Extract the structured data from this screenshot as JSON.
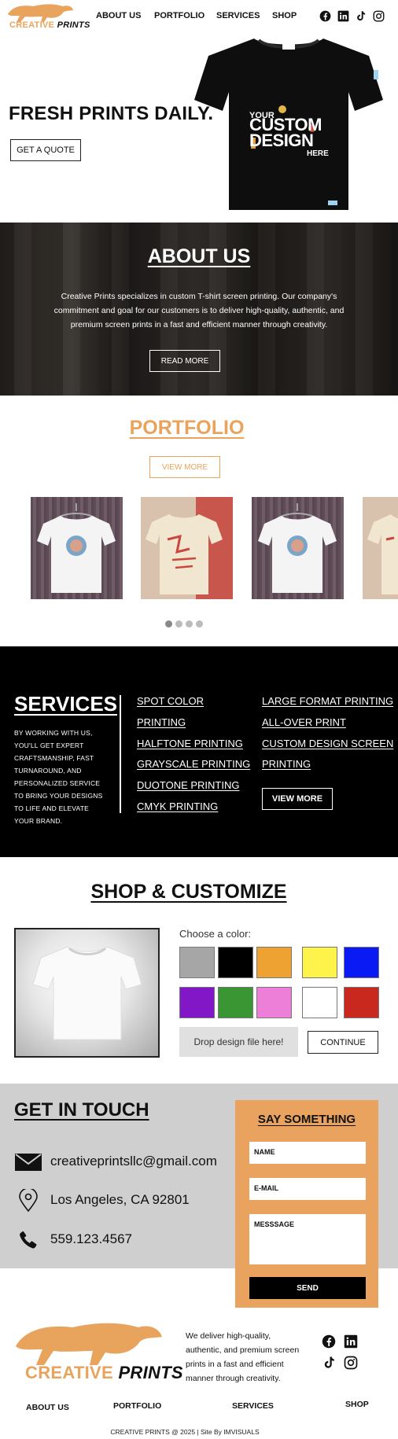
{
  "brand": {
    "logo_word_1": "CREATIVE",
    "logo_word_2": "PRINTS",
    "accent": "#e8a45c",
    "dark": "#000000"
  },
  "nav": {
    "items": [
      "ABOUT US",
      "PORTFOLIO",
      "SERVICES",
      "SHOP"
    ],
    "socials": [
      "facebook-icon",
      "linkedin-icon",
      "tiktok-icon",
      "instagram-icon"
    ]
  },
  "hero": {
    "title": "FRESH PRINTS DAILY.",
    "cta": "GET A QUOTE",
    "shirt_text_1": "YOUR",
    "shirt_text_2": "CUSTOM DESIGN",
    "shirt_text_3": "HERE"
  },
  "about": {
    "title": "ABOUT US",
    "body": "Creative Prints specializes in custom T-shirt screen printing. Our company's commitment and goal for our customers is to deliver high-quality, authentic, and premium screen prints in a fast and efficient manner through creativity.",
    "button": "READ MORE"
  },
  "portfolio": {
    "title": "PORTFOLIO",
    "button": "VIEW MORE",
    "cards": [
      "white-tee-on-hanger",
      "cream-graphic-tee",
      "white-tee-on-hanger",
      "cream-graphic-tee"
    ],
    "carousel_pages": 4,
    "carousel_active": 1
  },
  "services": {
    "title": "SERVICES",
    "description": "BY WORKING WITH US, YOU'LL GET EXPERT CRAFTSMANSHIP, FAST TURNAROUND, AND PERSONALIZED SERVICE TO BRING YOUR DESIGNS TO LIFE AND ELEVATE YOUR BRAND.",
    "col1": [
      "SPOT COLOR",
      "PRINTING",
      "HALFTONE PRINTING",
      "GRAYSCALE PRINTING",
      "DUOTONE PRINTING",
      "CMYK PRINTING"
    ],
    "col2": [
      "LARGE FORMAT PRINTING",
      "ALL-OVER PRINT",
      "CUSTOM DESIGN SCREEN",
      "PRINTING"
    ],
    "button": "VIEW MORE"
  },
  "shop": {
    "title": "SHOP & CUSTOMIZE",
    "color_label": "Choose a color:",
    "colors": [
      "#a6a6a6",
      "#000000",
      "#eea232",
      "#fdf34a",
      "#0a1af5",
      "#8117c7",
      "#3a9632",
      "#ee7fd9",
      "#ffffff",
      "#c9281f"
    ],
    "drop_label": "Drop design file here!",
    "continue": "CONTINUE"
  },
  "contact": {
    "title": "GET IN TOUCH",
    "email": "creativeprintsllc@gmail.com",
    "location": "Los Angeles, CA 92801",
    "phone": "559.123.4567",
    "form_title": "SAY SOMETHING",
    "field_name": "NAME",
    "field_email": "E-MAIL",
    "field_message": "MESSSAGE",
    "send": "SEND"
  },
  "footer": {
    "text": "We deliver high-quality, authentic, and premium screen prints in a fast and efficient manner through creativity.",
    "nav": [
      "ABOUT US",
      "PORTFOLIO",
      "SERVICES",
      "SHOP"
    ],
    "copyright": "CREATIVE PRINTS @ 2025 | Site By IMVISUALS"
  }
}
